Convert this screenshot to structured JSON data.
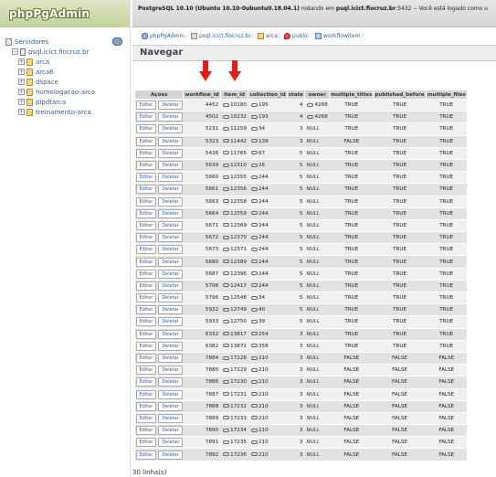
{
  "sidebar": {
    "logo": "phpPgAdmin",
    "servers_label": "Servidores",
    "server": "psql.icict.fiocruz.br",
    "databases": [
      "arca",
      "arca6",
      "dspace",
      "homologacao-arca",
      "pipdtarca",
      "treinamento-arca"
    ]
  },
  "topbar": {
    "product": "PostgreSQL 10.10 (Ubuntu 10.10-0ubuntu0.18.04.1)",
    "mid": " rodando em ",
    "host": "psql.icict.fiocruz.br",
    "tail": ":5432 -- Você está logado como u"
  },
  "breadcrumb": {
    "items": [
      "phpPgAdmin",
      "psql.icict.fiocruz.br",
      "arca",
      "public",
      "workflowitem"
    ]
  },
  "section": {
    "title": "Navegar"
  },
  "table": {
    "headers": [
      "Ações",
      "workflow_id",
      "item_id",
      "collection_id",
      "state",
      "owner",
      "multiple_titles",
      "published_before",
      "multiple_files"
    ],
    "edit_label": "Editar",
    "delete_label": "Deletar",
    "null_label": "NULL",
    "rows": [
      [
        "4452",
        "10180",
        "195",
        "4",
        "4268",
        "TRUE",
        "TRUE",
        "TRUE"
      ],
      [
        "4502",
        "10232",
        "193",
        "4",
        "4268",
        "TRUE",
        "TRUE",
        "TRUE"
      ],
      [
        "5231",
        "11259",
        "34",
        "3",
        "",
        "TRUE",
        "TRUE",
        "TRUE"
      ],
      [
        "5323",
        "11442",
        "139",
        "3",
        "",
        "FALSE",
        "TRUE",
        "TRUE"
      ],
      [
        "5436",
        "11765",
        "67",
        "5",
        "",
        "TRUE",
        "TRUE",
        "TRUE"
      ],
      [
        "5639",
        "12310",
        "26",
        "5",
        "",
        "TRUE",
        "TRUE",
        "TRUE"
      ],
      [
        "5660",
        "12355",
        "244",
        "5",
        "",
        "TRUE",
        "TRUE",
        "TRUE"
      ],
      [
        "5661",
        "12356",
        "244",
        "5",
        "",
        "TRUE",
        "TRUE",
        "TRUE"
      ],
      [
        "5663",
        "12358",
        "244",
        "5",
        "",
        "TRUE",
        "TRUE",
        "TRUE"
      ],
      [
        "5664",
        "12359",
        "244",
        "5",
        "",
        "TRUE",
        "TRUE",
        "TRUE"
      ],
      [
        "5671",
        "12369",
        "244",
        "5",
        "",
        "TRUE",
        "TRUE",
        "TRUE"
      ],
      [
        "5672",
        "12370",
        "244",
        "5",
        "",
        "TRUE",
        "TRUE",
        "TRUE"
      ],
      [
        "5673",
        "12371",
        "244",
        "5",
        "",
        "TRUE",
        "TRUE",
        "TRUE"
      ],
      [
        "5680",
        "12389",
        "244",
        "5",
        "",
        "TRUE",
        "TRUE",
        "TRUE"
      ],
      [
        "5687",
        "12396",
        "244",
        "5",
        "",
        "TRUE",
        "TRUE",
        "TRUE"
      ],
      [
        "5706",
        "12417",
        "244",
        "5",
        "",
        "TRUE",
        "TRUE",
        "TRUE"
      ],
      [
        "5796",
        "12548",
        "34",
        "5",
        "",
        "TRUE",
        "TRUE",
        "TRUE"
      ],
      [
        "5932",
        "12749",
        "40",
        "5",
        "",
        "TRUE",
        "TRUE",
        "TRUE"
      ],
      [
        "5933",
        "12750",
        "39",
        "5",
        "",
        "TRUE",
        "TRUE",
        "TRUE"
      ],
      [
        "6332",
        "13817",
        "254",
        "3",
        "",
        "TRUE",
        "TRUE",
        "TRUE"
      ],
      [
        "6382",
        "13872",
        "358",
        "3",
        "",
        "TRUE",
        "TRUE",
        "TRUE"
      ],
      [
        "7884",
        "17228",
        "210",
        "3",
        "",
        "FALSE",
        "FALSE",
        "FALSE"
      ],
      [
        "7885",
        "17229",
        "210",
        "3",
        "",
        "FALSE",
        "FALSE",
        "FALSE"
      ],
      [
        "7886",
        "17230",
        "210",
        "3",
        "",
        "FALSE",
        "FALSE",
        "FALSE"
      ],
      [
        "7887",
        "17231",
        "210",
        "3",
        "",
        "FALSE",
        "FALSE",
        "FALSE"
      ],
      [
        "7888",
        "17232",
        "210",
        "3",
        "",
        "FALSE",
        "FALSE",
        "FALSE"
      ],
      [
        "7889",
        "17233",
        "210",
        "3",
        "",
        "FALSE",
        "FALSE",
        "FALSE"
      ],
      [
        "7890",
        "17234",
        "210",
        "3",
        "",
        "FALSE",
        "FALSE",
        "FALSE"
      ],
      [
        "7891",
        "17235",
        "210",
        "3",
        "",
        "FALSE",
        "FALSE",
        "FALSE"
      ],
      [
        "7892",
        "17236",
        "210",
        "3",
        "",
        "FALSE",
        "FALSE",
        "FALSE"
      ]
    ]
  },
  "footer": {
    "row_count": "30 linha(s)"
  },
  "colors": {
    "arrow": "#e0201c",
    "link": "#3a5e9e"
  }
}
